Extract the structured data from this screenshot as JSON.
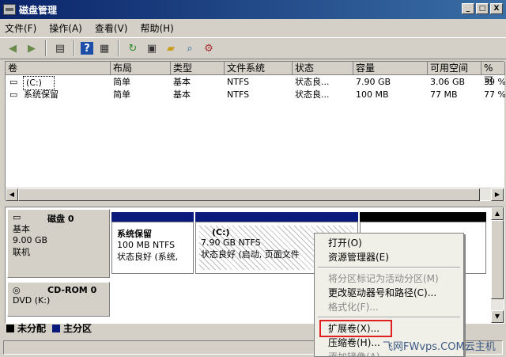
{
  "window": {
    "title": "磁盘管理",
    "buttons": [
      "_",
      "□",
      "X"
    ]
  },
  "menu": [
    "文件(F)",
    "操作(A)",
    "查看(V)",
    "帮助(H)"
  ],
  "toolbar_icons": [
    "back-arrow-icon",
    "forward-arrow-icon",
    "console-tree-icon",
    "help-icon",
    "panel-icon",
    "refresh-icon",
    "properties-icon",
    "open-folder-icon",
    "search-icon",
    "settings-icon"
  ],
  "volume_table": {
    "headers": [
      "卷",
      "布局",
      "类型",
      "文件系统",
      "状态",
      "容量",
      "可用空间",
      "% 可"
    ],
    "rows": [
      [
        "(C:)",
        "简单",
        "基本",
        "NTFS",
        "状态良...",
        "7.90 GB",
        "3.06 GB",
        "39 %"
      ],
      [
        "系统保留",
        "简单",
        "基本",
        "NTFS",
        "状态良...",
        "100 MB",
        "77 MB",
        "77 %"
      ]
    ]
  },
  "disks": [
    {
      "name": "磁盘 0",
      "type": "基本",
      "size": "9.00 GB",
      "status": "联机",
      "partitions": [
        {
          "title": "系统保留",
          "size": "100 MB NTFS",
          "status": "状态良好 (系统,",
          "color": "#0a1a7c"
        },
        {
          "title": "(C:)",
          "size": "7.90 GB NTFS",
          "status": "状态良好 (启动, 页面文件",
          "color": "#0a1a7c"
        },
        {
          "title": "",
          "size": "",
          "status": "",
          "color": "#000000"
        }
      ]
    },
    {
      "name": "CD-ROM 0",
      "type": "DVD (K:)"
    }
  ],
  "legend": [
    {
      "label": "未分配",
      "color": "#000000"
    },
    {
      "label": "主分区",
      "color": "#0a1a7c"
    }
  ],
  "context_menu": {
    "items": [
      {
        "label": "打开(O)",
        "enabled": true
      },
      {
        "label": "资源管理器(E)",
        "enabled": true
      },
      {
        "sep": true
      },
      {
        "label": "将分区标记为活动分区(M)",
        "enabled": false
      },
      {
        "label": "更改驱动器号和路径(C)...",
        "enabled": true
      },
      {
        "label": "格式化(F)...",
        "enabled": false
      },
      {
        "sep": true
      },
      {
        "label": "扩展卷(X)...",
        "enabled": true
      },
      {
        "label": "压缩卷(H)...",
        "enabled": true
      },
      {
        "label": "添加镜像(A)...",
        "enabled": false
      }
    ]
  },
  "watermark": "飞网FWvps.COM云主机"
}
